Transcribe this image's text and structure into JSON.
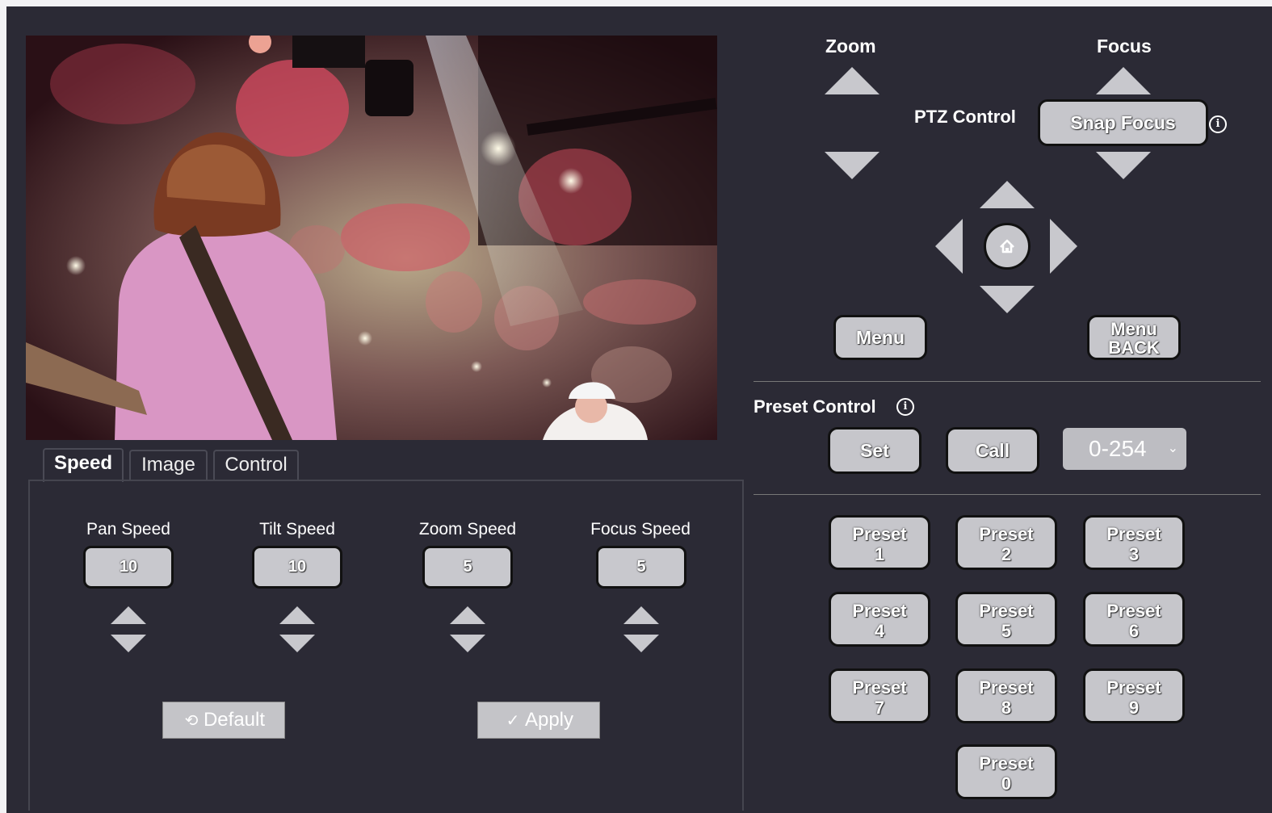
{
  "tabs": [
    {
      "label": "Speed",
      "active": true
    },
    {
      "label": "Image",
      "active": false
    },
    {
      "label": "Control",
      "active": false
    }
  ],
  "speed": {
    "items": [
      {
        "label": "Pan Speed",
        "value": "10"
      },
      {
        "label": "Tilt Speed",
        "value": "10"
      },
      {
        "label": "Zoom Speed",
        "value": "5"
      },
      {
        "label": "Focus Speed",
        "value": "5"
      }
    ],
    "default_label": "Default",
    "apply_label": "Apply"
  },
  "ptz": {
    "zoom_label": "Zoom",
    "focus_label": "Focus",
    "title": "PTZ Control",
    "snap_focus_label": "Snap Focus",
    "menu_label": "Menu",
    "menu_back_line1": "Menu",
    "menu_back_line2": "BACK",
    "info_icon": "info-icon",
    "home_icon": "home-icon"
  },
  "preset": {
    "title": "Preset Control",
    "set_label": "Set",
    "call_label": "Call",
    "range_value": "0-254",
    "buttons": [
      {
        "line1": "Preset",
        "line2": "1"
      },
      {
        "line1": "Preset",
        "line2": "2"
      },
      {
        "line1": "Preset",
        "line2": "3"
      },
      {
        "line1": "Preset",
        "line2": "4"
      },
      {
        "line1": "Preset",
        "line2": "5"
      },
      {
        "line1": "Preset",
        "line2": "6"
      },
      {
        "line1": "Preset",
        "line2": "7"
      },
      {
        "line1": "Preset",
        "line2": "8"
      },
      {
        "line1": "Preset",
        "line2": "9"
      },
      {
        "line1": "Preset",
        "line2": "0"
      }
    ]
  },
  "colors": {
    "background": "#2b2a35",
    "button": "#c6c6cb",
    "button_border": "#111111"
  }
}
